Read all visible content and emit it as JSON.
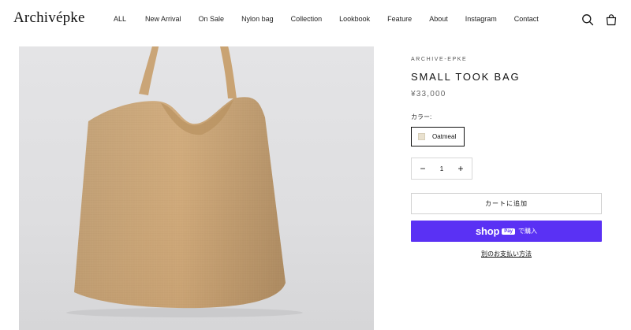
{
  "header": {
    "logo": "Archivépke",
    "nav": [
      "ALL",
      "New Arrival",
      "On Sale",
      "Nylon bag",
      "Collection",
      "Lookbook",
      "Feature",
      "About",
      "Instagram",
      "Contact"
    ],
    "icons": [
      "search-icon",
      "bag-icon"
    ]
  },
  "product": {
    "vendor": "ARCHIVE-EPKE",
    "title": "SMALL TOOK BAG",
    "price": "¥33,000",
    "color_label": "カラー:",
    "color_option": "Oatmeal",
    "swatch_color": "#e9e1cf",
    "quantity": "1",
    "qty_minus": "−",
    "qty_plus": "+",
    "add_to_cart": "カートに追加",
    "shop_pay": {
      "brand": "shop",
      "pill": "Pay",
      "suffix": "で購入",
      "color": "#5a31f4"
    },
    "more_payment": "別のお支払い方法"
  }
}
